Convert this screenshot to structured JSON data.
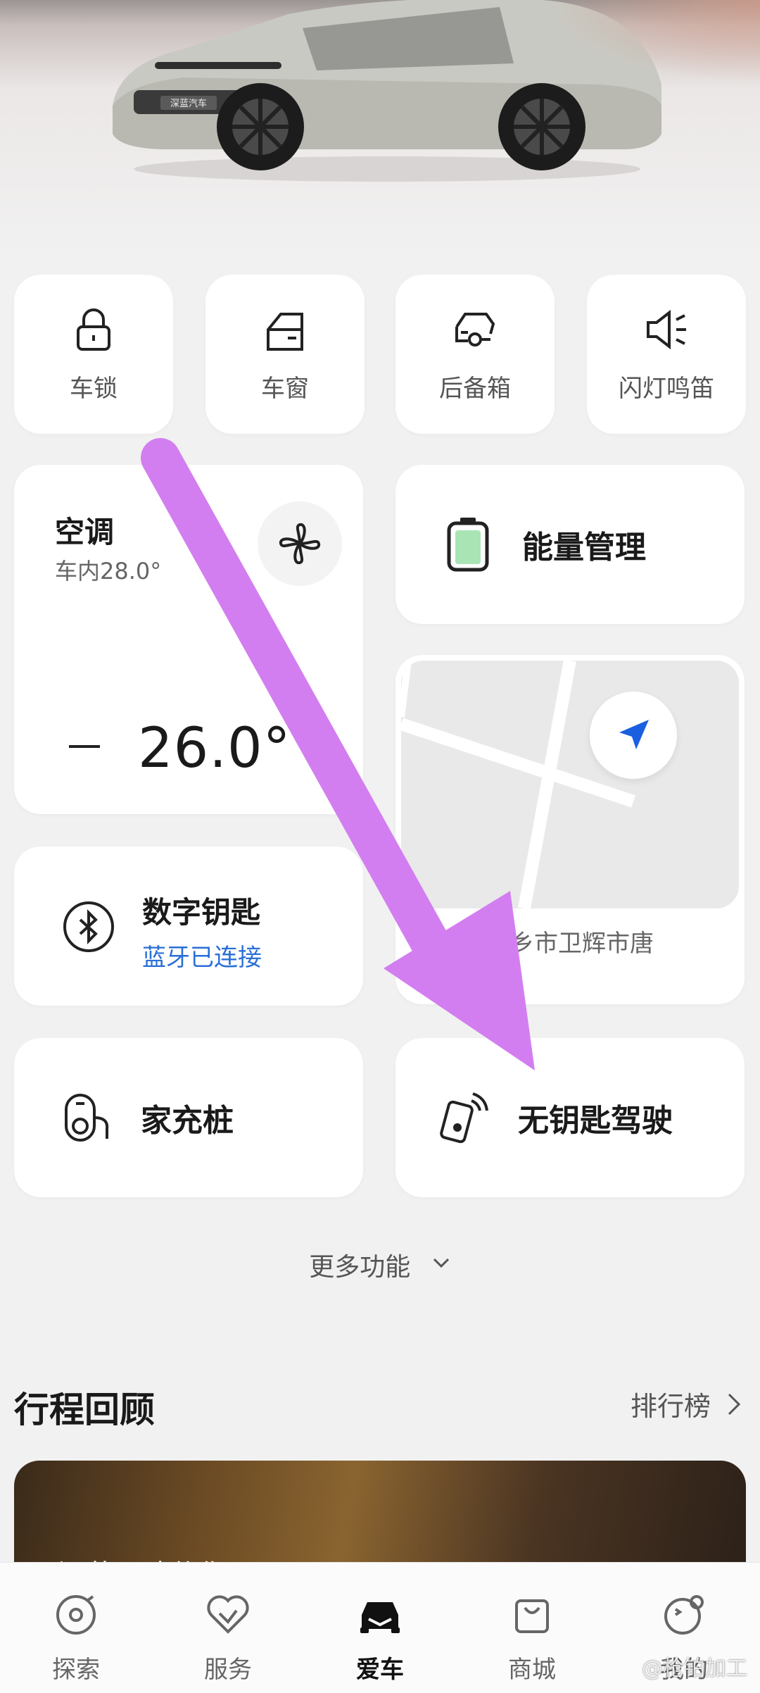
{
  "hero": {
    "brand_plate": "深蓝汽车"
  },
  "quick_actions": [
    {
      "label": "车锁",
      "icon": "lock-icon"
    },
    {
      "label": "车窗",
      "icon": "car-window-icon"
    },
    {
      "label": "后备箱",
      "icon": "trunk-icon"
    },
    {
      "label": "闪灯鸣笛",
      "icon": "horn-light-icon"
    }
  ],
  "climate": {
    "title": "空调",
    "interior": "车内28.0°",
    "set_temp": "26.0°",
    "icon": "fan-icon"
  },
  "energy": {
    "label": "能量管理",
    "icon": "battery-icon"
  },
  "map": {
    "location": "新乡市卫辉市唐",
    "icon": "navigation-arrow-icon"
  },
  "digital_key": {
    "title": "数字钥匙",
    "status": "蓝牙已连接",
    "icon": "bluetooth-icon",
    "status_color": "#2a6fd6"
  },
  "home_charger": {
    "label": "家充桩",
    "icon": "charger-icon"
  },
  "keyless": {
    "label": "无钥匙驾驶",
    "icon": "phone-key-icon"
  },
  "more": {
    "label": "更多功能"
  },
  "trip": {
    "title": "行程回顾",
    "rank_label": "排行榜",
    "banner_text": "深蓝已陪伴你"
  },
  "nav": [
    {
      "label": "探索",
      "icon": "explore-icon",
      "active": false
    },
    {
      "label": "服务",
      "icon": "service-icon",
      "active": false
    },
    {
      "label": "爱车",
      "icon": "car-icon",
      "active": true
    },
    {
      "label": "商城",
      "icon": "shop-icon",
      "active": false
    },
    {
      "label": "我的",
      "icon": "profile-icon",
      "active": false
    }
  ],
  "watermark": "@枪铂加工",
  "colors": {
    "accent_blue": "#1a5fe0",
    "annotation_purple": "#d37ef0",
    "battery_green": "#a9e4b5"
  }
}
